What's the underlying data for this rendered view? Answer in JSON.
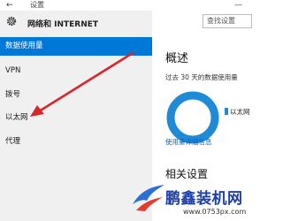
{
  "window": {
    "title": "设置",
    "back_glyph": "←",
    "minimize_glyph": "—"
  },
  "header": {
    "title": "网络和 INTERNET",
    "search_placeholder": "查找设置"
  },
  "sidebar": {
    "items": [
      {
        "label": "数据使用量",
        "selected": true
      },
      {
        "label": "VPN",
        "selected": false
      },
      {
        "label": "拨号",
        "selected": false
      },
      {
        "label": "以太网",
        "selected": false
      },
      {
        "label": "代理",
        "selected": false
      }
    ]
  },
  "main": {
    "overview_title": "概述",
    "usage_description": "过去 30 天的数据使用量",
    "legend": [
      {
        "name": "以太网",
        "color": "#1f8bd6"
      }
    ],
    "details_link": "使用量详细信息",
    "related_title": "相关设置"
  },
  "annotation": {
    "color": "#d9262b"
  },
  "watermark": {
    "brand": "鹏鑫装机网",
    "url": "www.0753px.com",
    "color": "#1d3fa8"
  },
  "colors": {
    "accent": "#0078d7",
    "sidebar_bg": "#f0f0f0",
    "link": "#0b63c5"
  }
}
